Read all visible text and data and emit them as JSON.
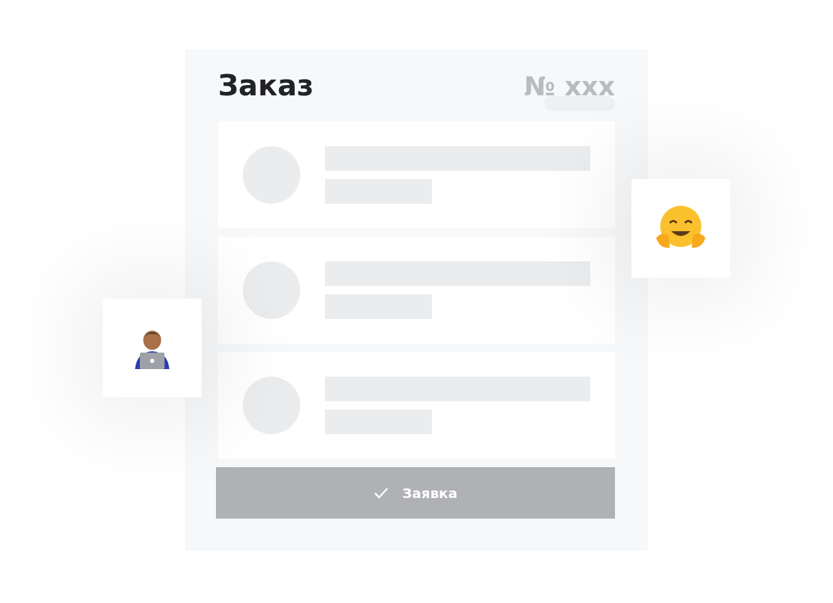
{
  "order": {
    "title": "Заказ",
    "number": "№ xxx"
  },
  "items": [
    {
      "kind": "skeleton"
    },
    {
      "kind": "skeleton"
    },
    {
      "kind": "skeleton"
    }
  ],
  "button": {
    "label": "Заявка"
  },
  "stickers": [
    {
      "kind": "developer"
    },
    {
      "kind": "hugging"
    }
  ]
}
